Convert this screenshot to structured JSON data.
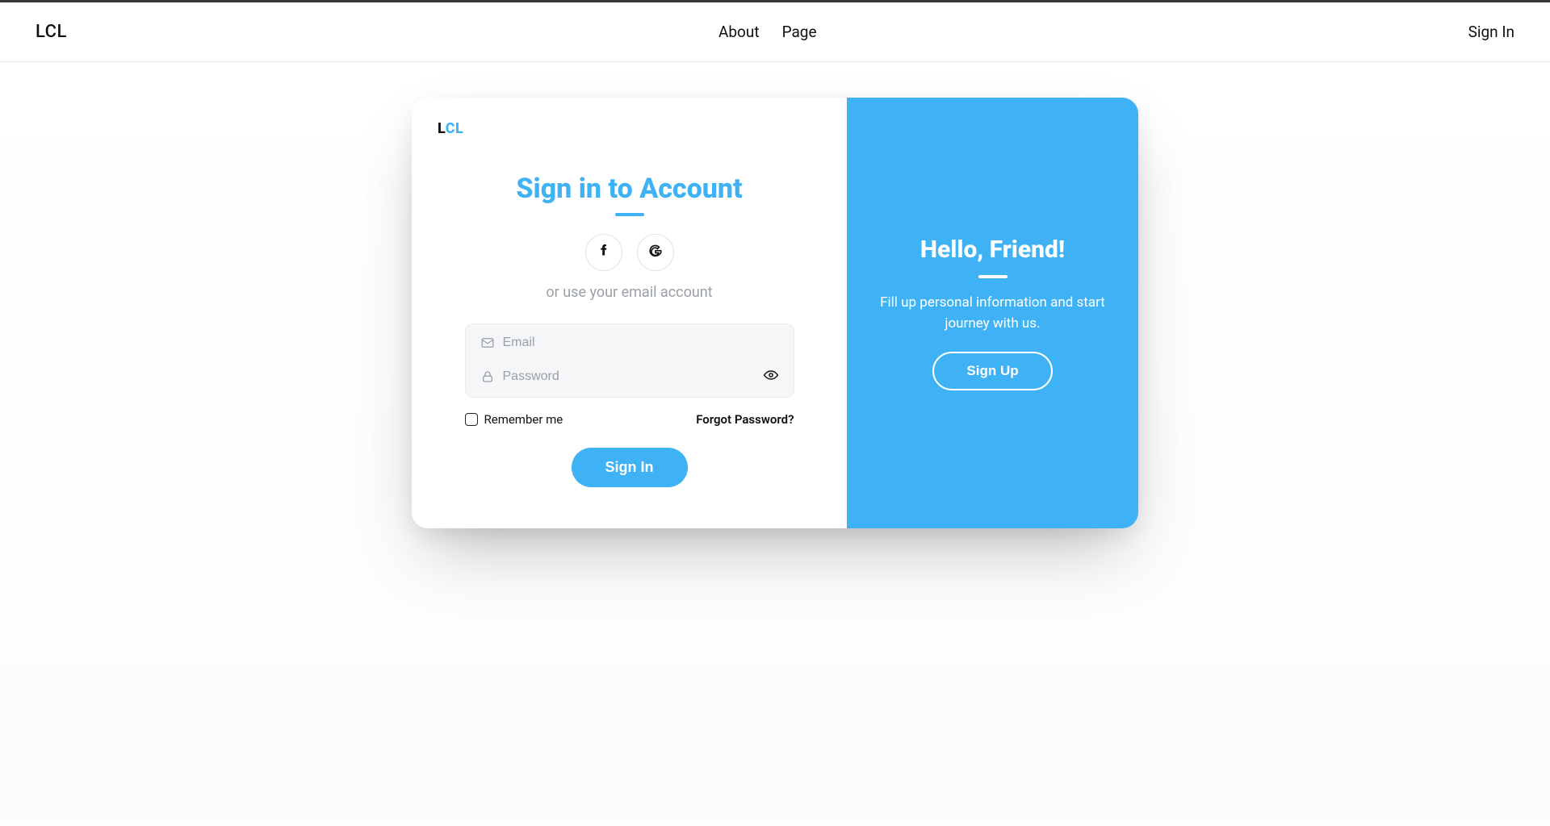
{
  "header": {
    "brand": "LCL",
    "nav": {
      "about": "About",
      "page": "Page"
    },
    "sign_in": "Sign In"
  },
  "card": {
    "logo": {
      "part1": "L",
      "part2": "CL"
    },
    "title": "Sign in to Account",
    "or_text": "or use your email account",
    "email_placeholder": "Email",
    "password_placeholder": "Password",
    "remember_label": "Remember me",
    "forgot_label": "Forgot Password?",
    "signin_button": "Sign In"
  },
  "right": {
    "hello": "Hello, Friend!",
    "subtext": "Fill up personal information and start journey with us.",
    "signup_button": "Sign Up"
  },
  "colors": {
    "accent": "#3eb2f5"
  }
}
